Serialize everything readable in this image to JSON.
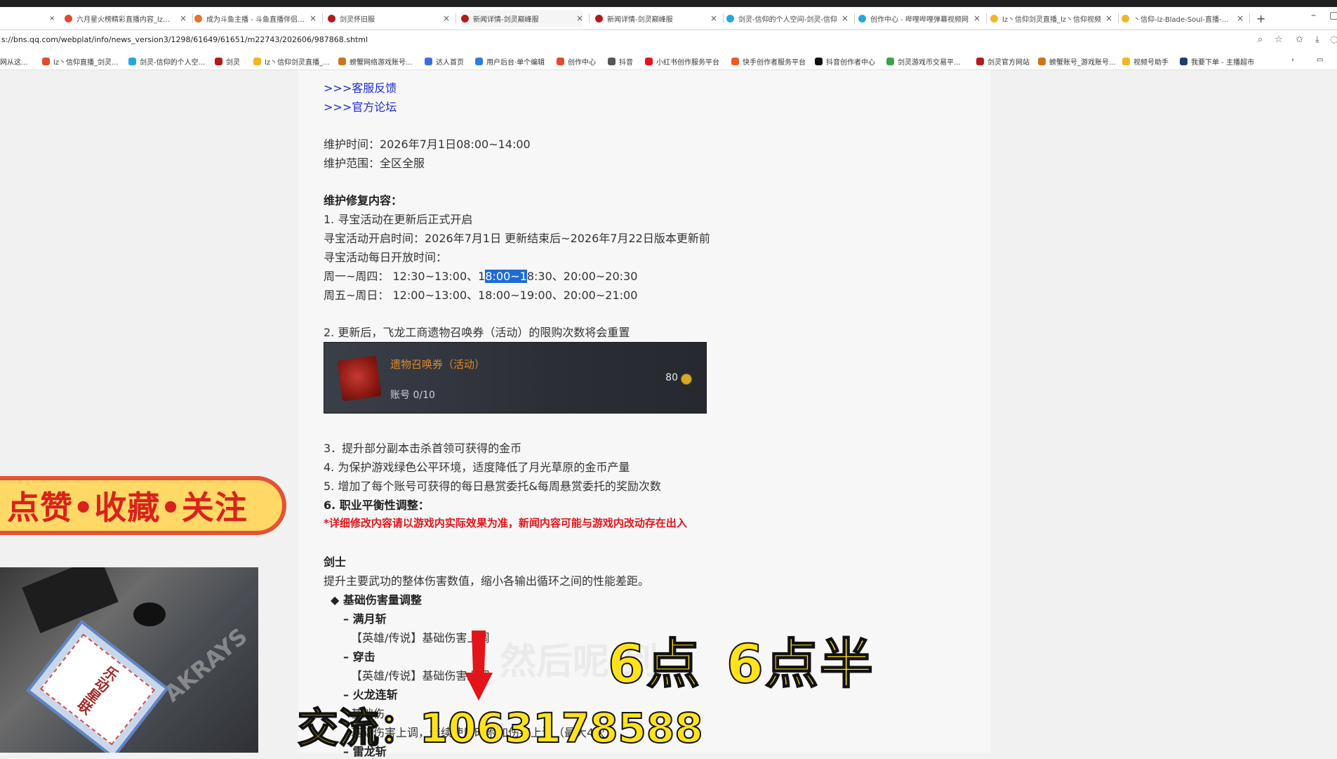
{
  "browser": {
    "tabs": [
      {
        "label": "六月星火榜精彩直播内容_lz丶信",
        "color": "#e34a2b"
      },
      {
        "label": "成为斗鱼主播 - 斗鱼直播伴侣下载",
        "color": "#e8732a"
      },
      {
        "label": "剑灵怀旧服",
        "color": "#b31b1b"
      },
      {
        "label": "新闻详情-剑灵巅峰服",
        "color": "#b31b1b"
      },
      {
        "label": "新闻详情-剑灵巅峰服",
        "color": "#b31b1b"
      },
      {
        "label": "剑灵-信仰的个人空间-剑灵-信仰",
        "color": "#23a7e0"
      },
      {
        "label": "创作中心 - 哔哩哔哩弹幕视频网",
        "color": "#23a7e0"
      },
      {
        "label": "lz丶信仰剑灵直播_lz丶信仰视频",
        "color": "#f1b526"
      },
      {
        "label": "丶信仰-lz-Blade-Soul-直播-精彩",
        "color": "#f1b526"
      }
    ],
    "tab_close": "×",
    "new_tab": "+",
    "minimize": "–",
    "url": "s://bns.qq.com/webplat/info/news_version3/1298/61649/61651/m22743/202606/987868.shtml",
    "bookmarks": [
      {
        "label": "网从这...",
        "color": "#ffffff"
      },
      {
        "label": "lz丶信仰直播_剑灵...",
        "color": "#e34a2b"
      },
      {
        "label": "剑灵-信仰的个人空...",
        "color": "#23a7e0"
      },
      {
        "label": "剑灵",
        "color": "#b31b1b"
      },
      {
        "label": "lz丶信仰剑灵直播_...",
        "color": "#f1b526"
      },
      {
        "label": "螃蟹网络游戏账号...",
        "color": "#d0741a"
      },
      {
        "label": "达人首页",
        "color": "#3b6fe0"
      },
      {
        "label": "用户后台·单个编辑",
        "color": "#2f7de0"
      },
      {
        "label": "创作中心",
        "color": "#e34a2b"
      },
      {
        "label": "抖音",
        "color": "#555555"
      },
      {
        "label": "小红书创作服务平台",
        "color": "#e3141a"
      },
      {
        "label": "快手创作者服务平台",
        "color": "#f05a22"
      },
      {
        "label": "抖音创作者中心",
        "color": "#111111"
      },
      {
        "label": "剑灵游戏币交易平...",
        "color": "#3aa34a"
      },
      {
        "label": "剑灵官方网站",
        "color": "#b31b1b"
      },
      {
        "label": "螃蟹账号_游戏账号...",
        "color": "#d0741a"
      },
      {
        "label": "视频号助手",
        "color": "#f1b526"
      },
      {
        "label": "我要下单 - 主播超市",
        "color": "#1f3b6f"
      }
    ]
  },
  "article": {
    "link1": ">>>客服反馈",
    "link2": ">>>官方论坛",
    "maint_time": "维护时间：2026年7月1日08:00~14:00",
    "maint_scope": "维护范围：全区全服",
    "section_title": "维护修复内容：",
    "item1": "1. 寻宝活动在更新后正式开启",
    "item1_time": "寻宝活动开启时间：2026年7月1日 更新结束后~2026年7月22日版本更新前",
    "item1_daily": "寻宝活动每日开放时间：",
    "weekday_pre": "周一~周四：  12:30~13:00、1",
    "weekday_hl": "8:00~1",
    "weekday_post": "8:30、20:00~20:30",
    "weekend": "周五~周日：  12:00~13:00、18:00~19:00、20:00~21:00",
    "item2": "2. 更新后，飞龙工商遗物召唤券（活动）的限购次数将会重置",
    "card_name": "遗物召唤券（活动）",
    "card_limit": "账号 0/10",
    "card_price": "80",
    "item3": "3．提升部分副本击杀首领可获得的金币",
    "item4": "4. 为保护游戏绿色公平环境，适度降低了月光草原的金币产量",
    "item5": "5. 增加了每个账号可获得的每日悬赏委托&每周悬赏委托的奖励次数",
    "item6": "6. 职业平衡性调整：",
    "note": "*详细修改内容请以游戏内实际效果为准，新闻内容可能与游戏内改动存在出入",
    "class_name": "剑士",
    "class_desc": "提升主要武功的整体伤害数值，缩小各输出循环之间的性能差距。",
    "sub1": "◆ 基础伤害量调整",
    "skill1": "– 满月斩",
    "skill1_detail": "【英雄/传说】基础伤害上调",
    "skill2": "– 穿击",
    "skill2_detail": "【英雄/传说】基础伤害上调",
    "skill3": "– 火龙连斩",
    "skill3_detail": "基础伤",
    "skill3_detail2": "基础伤害上调，连续使用时附加伤害上调（最大4次）",
    "skill4": "– 雷龙斩"
  },
  "overlay": {
    "banner": "点赞•收藏•关注",
    "cam_sign": "乐动星联",
    "cam_logo": "AKRAYS",
    "ghost_caption": "然后呢  到",
    "caption_a": "6点",
    "caption_b": "6点半",
    "contact": "交流：1063178588"
  }
}
